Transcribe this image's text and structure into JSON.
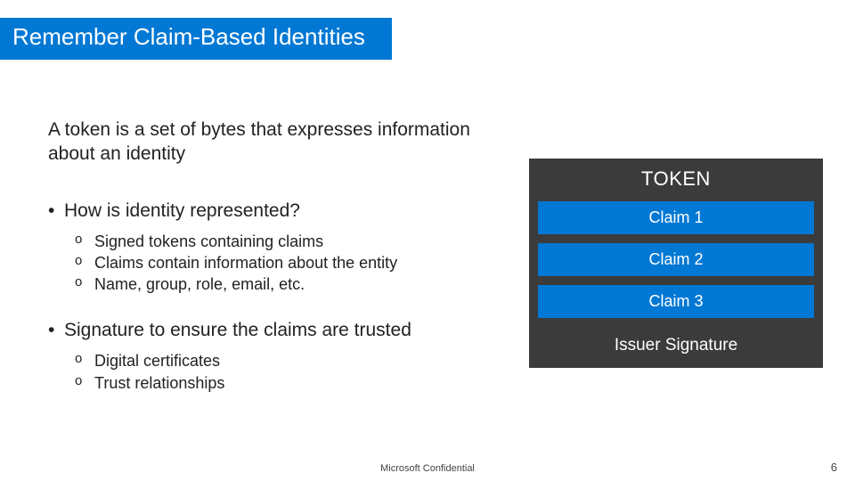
{
  "title": "Remember Claim-Based Identities",
  "intro": "A token is a set of bytes that expresses information about an identity",
  "bullets": [
    {
      "text": "How is identity represented?",
      "subs": [
        "Signed tokens containing claims",
        "Claims contain information about the entity",
        "Name, group, role, email, etc."
      ]
    },
    {
      "text": "Signature to ensure the claims are trusted",
      "subs": [
        "Digital certificates",
        "Trust relationships"
      ]
    }
  ],
  "token": {
    "header": "TOKEN",
    "claims": [
      "Claim 1",
      "Claim 2",
      "Claim 3"
    ],
    "issuer": "Issuer Signature"
  },
  "footer": "Microsoft Confidential",
  "page_number": "6"
}
